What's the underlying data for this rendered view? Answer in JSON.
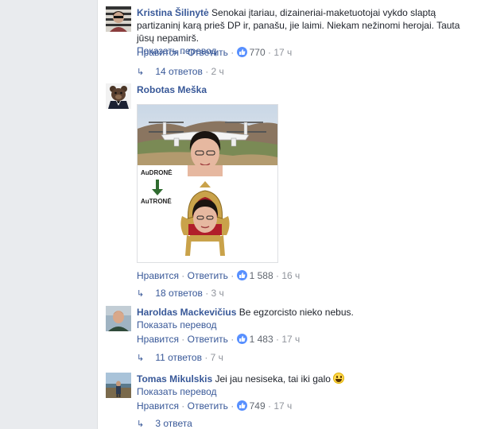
{
  "common": {
    "translate_label": "Показать перевод",
    "like_label": "Нравится",
    "reply_label": "Ответить",
    "separator": "·"
  },
  "comments": [
    {
      "author": "Kristina Šilinytė",
      "text": "Senokai įtariau, dizaineriai-maketuotojai vykdo slaptą partizaninį karą prieš DP ir, panašu, jie laimi. Niekam nežinomi herojai. Tauta jūsų nepamirš.",
      "reactions": "770",
      "time": "17 ч",
      "replies": "14 ответов",
      "replies_time": "2 ч"
    },
    {
      "author": "Robotas Meška",
      "image_label_top": "AuDRONĖ",
      "image_label_bottom": "AuTRONĖ",
      "reactions": "1 588",
      "time": "16 ч",
      "replies": "18 ответов",
      "replies_time": "3 ч"
    },
    {
      "author": "Haroldas Mackevičius",
      "text": "Be egzorcisto nieko nebus.",
      "reactions": "1 483",
      "time": "17 ч",
      "replies": "11 ответов",
      "replies_time": "7 ч"
    },
    {
      "author": "Tomas Mikulskis",
      "text": "Jei jau nesiseka, tai iki galo",
      "reactions": "749",
      "time": "17 ч",
      "replies": "3 ответа"
    }
  ],
  "colors": {
    "link": "#385898",
    "like_icon": "#5890ff",
    "muted": "#90949c"
  }
}
